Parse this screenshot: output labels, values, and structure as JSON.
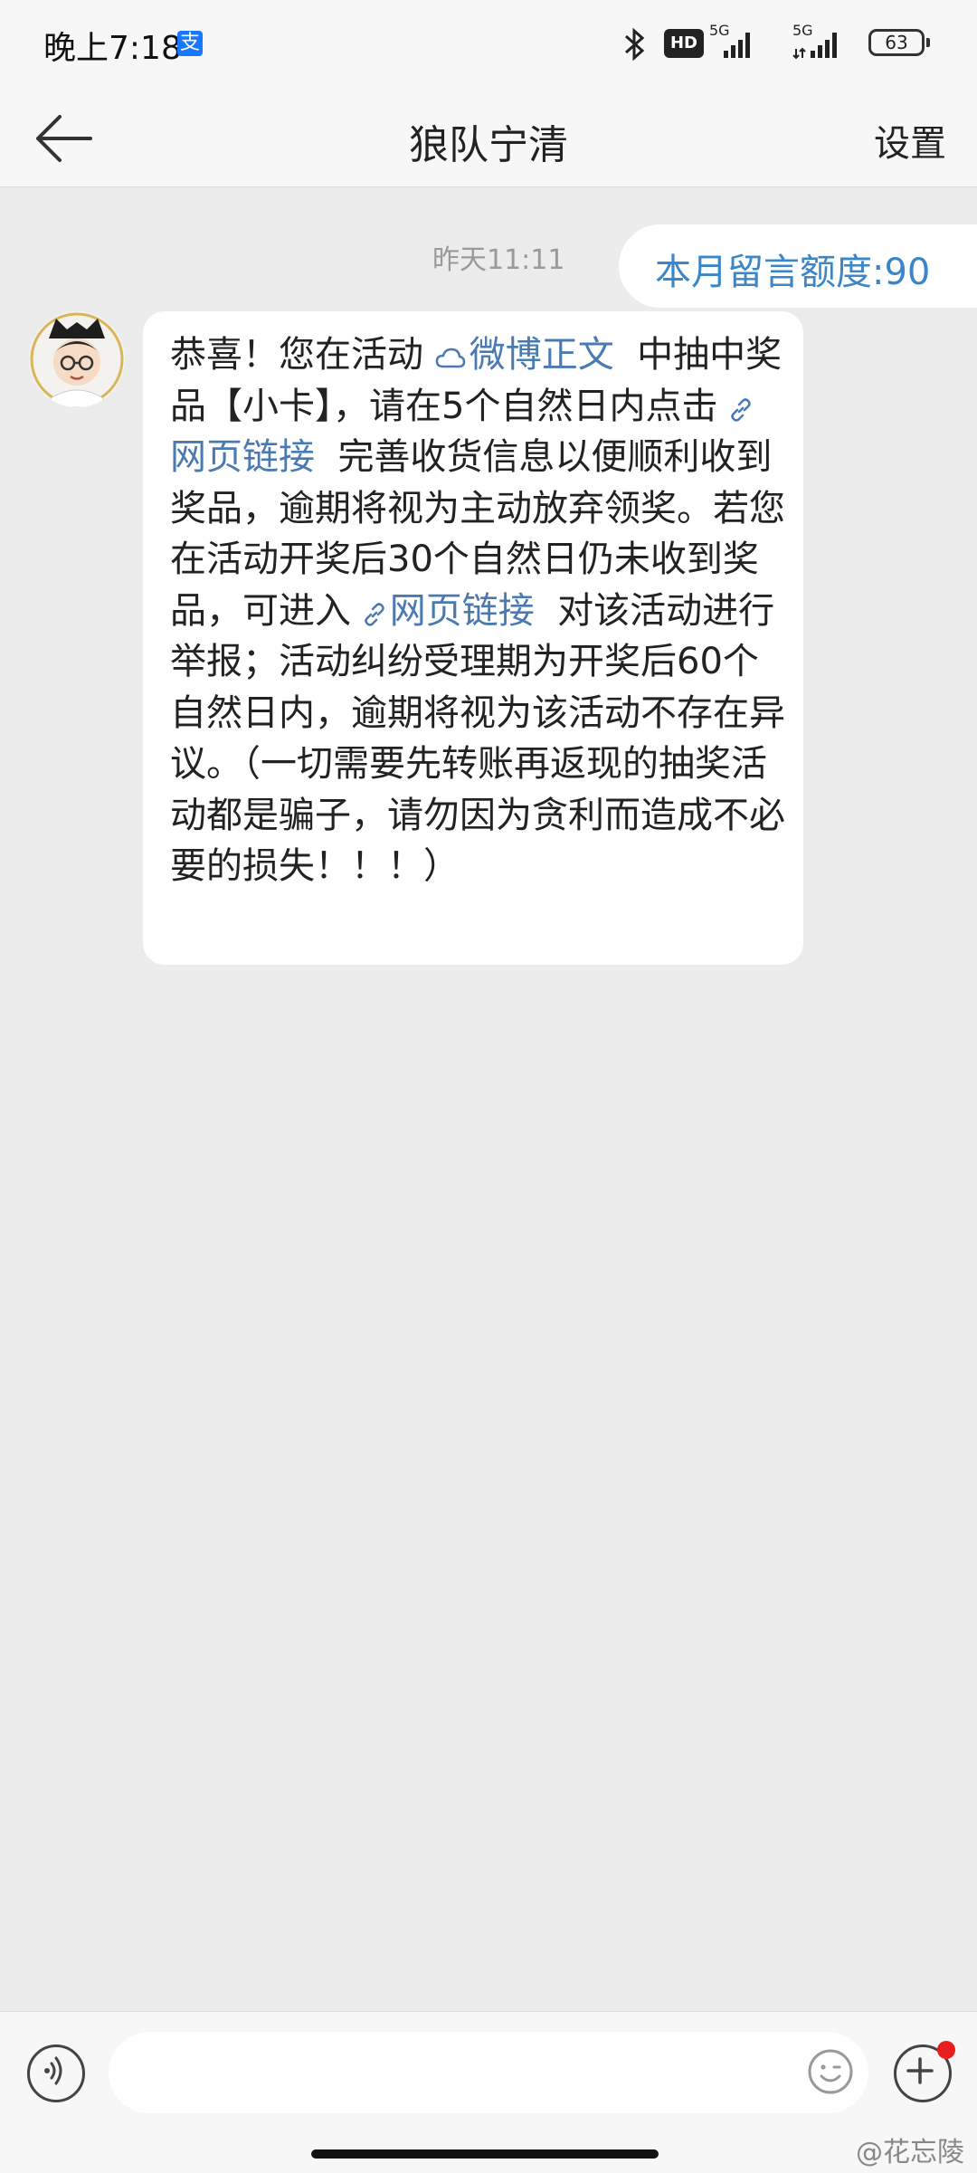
{
  "status_bar": {
    "time": "晚上7:18",
    "hd_badge": "HD",
    "signal1_label": "5G",
    "signal2_label": "5G",
    "battery": "63"
  },
  "header": {
    "title": "狼队宁清",
    "settings_label": "设置"
  },
  "chat": {
    "timestamp": "昨天11:11",
    "quota_message": "本月留言额度:90",
    "message": {
      "part1": "恭喜！您在活动",
      "link1": "微博正文",
      "part2": "中抽中奖品【小卡】，请在5个自然日内点击",
      "link2": "网页链接",
      "part3": "完善收货信息以便顺利收到奖品，逾期将视为主动放弃领奖。若您在活动开奖后30个自然日仍未收到奖品，可进入",
      "link3": "网页链接",
      "part4": "对该活动进行举报；活动纠纷受理期为开奖后60个自然日内，逾期将视为该活动不存在异议。（一切需要先转账再返现的抽奖活动都是骗子，请勿因为贪利而造成不必要的损失！！！）"
    }
  },
  "input": {
    "placeholder": ""
  },
  "watermark": "@花忘陵",
  "colors": {
    "link": "#4a7ab0",
    "quota_text": "#3a86c8",
    "notification_dot": "#e61e1e"
  },
  "icons": [
    "back-arrow-icon",
    "bluetooth-icon",
    "voice-icon",
    "emoji-icon",
    "plus-icon",
    "cloud-icon",
    "link-icon"
  ]
}
